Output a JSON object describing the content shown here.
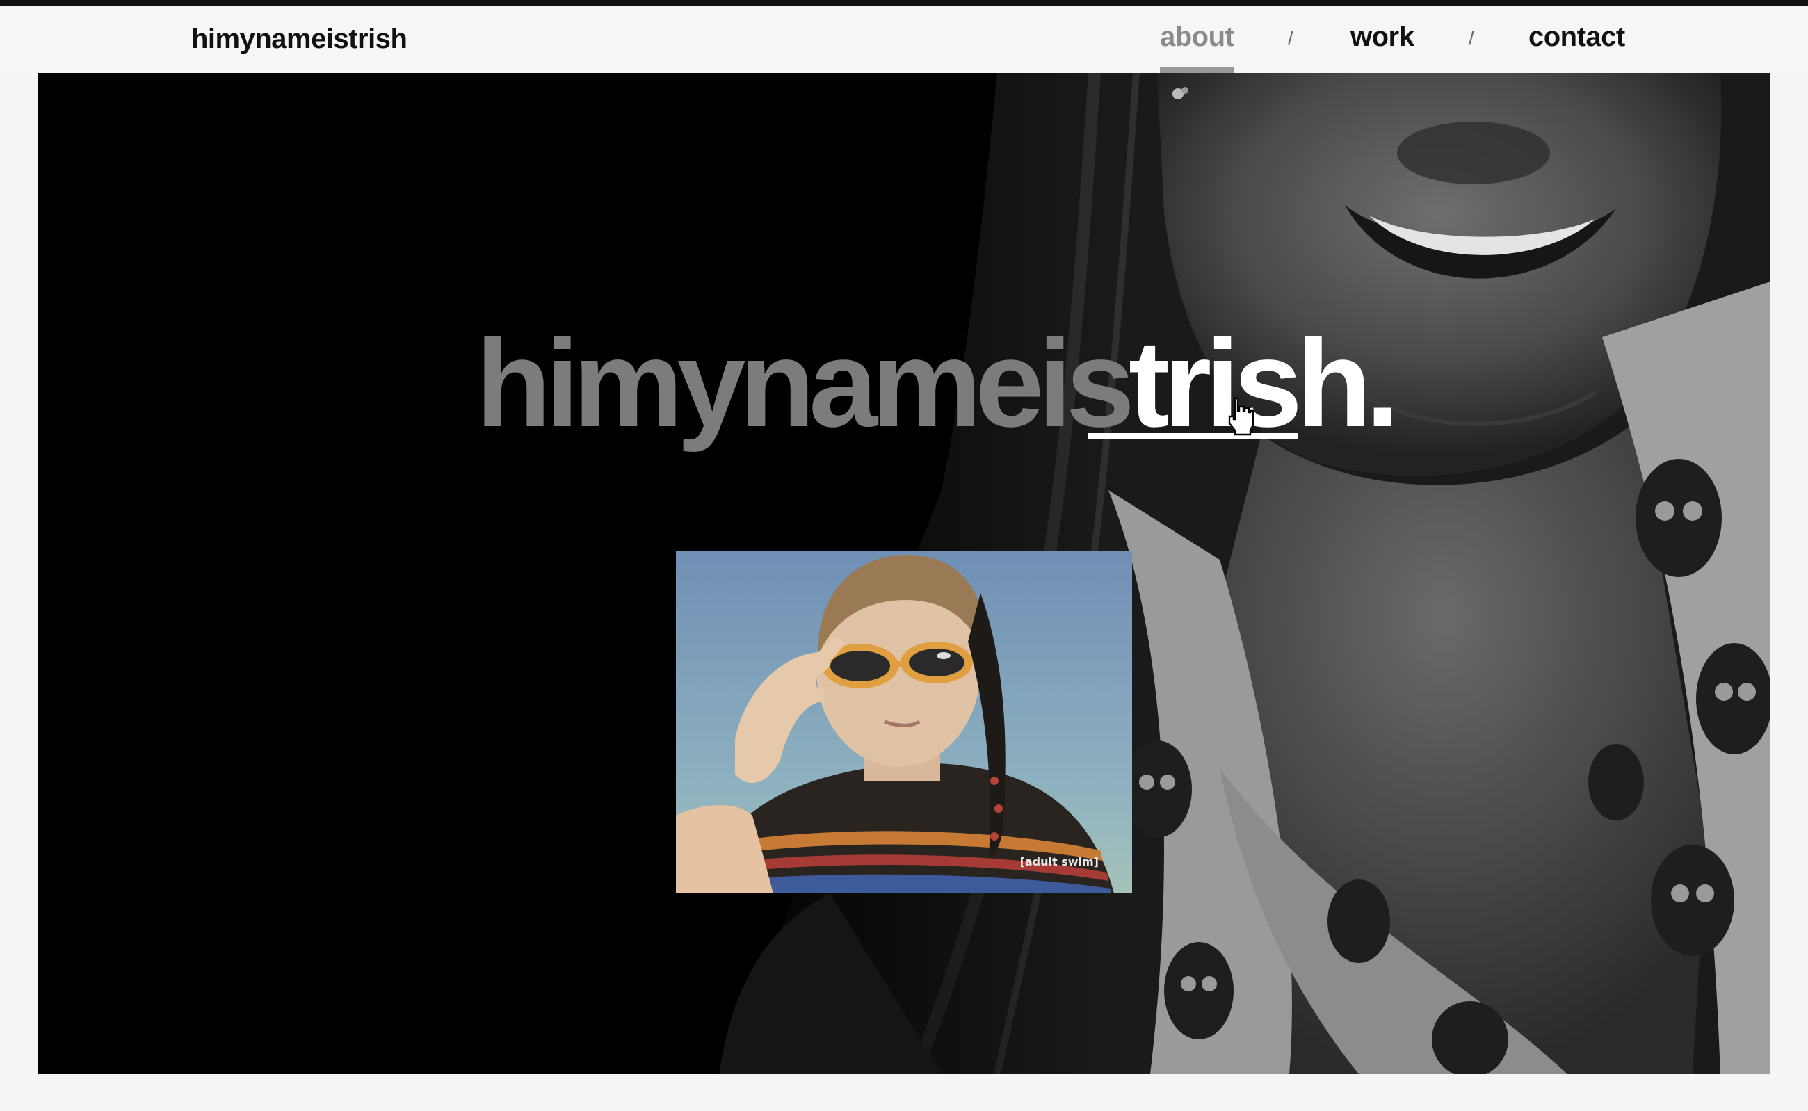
{
  "header": {
    "logo": "himynameistrish",
    "nav": [
      {
        "label": "about",
        "active": true
      },
      {
        "label": "work",
        "active": false
      },
      {
        "label": "contact",
        "active": false
      }
    ],
    "separator": "/"
  },
  "hero": {
    "headline_grey": "himynameis",
    "headline_white": "trish."
  },
  "gif": {
    "caption": "[adult swim]"
  },
  "colors": {
    "background": "#f6f6f6",
    "hero": "#000000",
    "headline_grey": "#7c7c7c",
    "headline_white": "#ffffff",
    "nav_active": "#8a8a8a",
    "text": "#111111"
  }
}
